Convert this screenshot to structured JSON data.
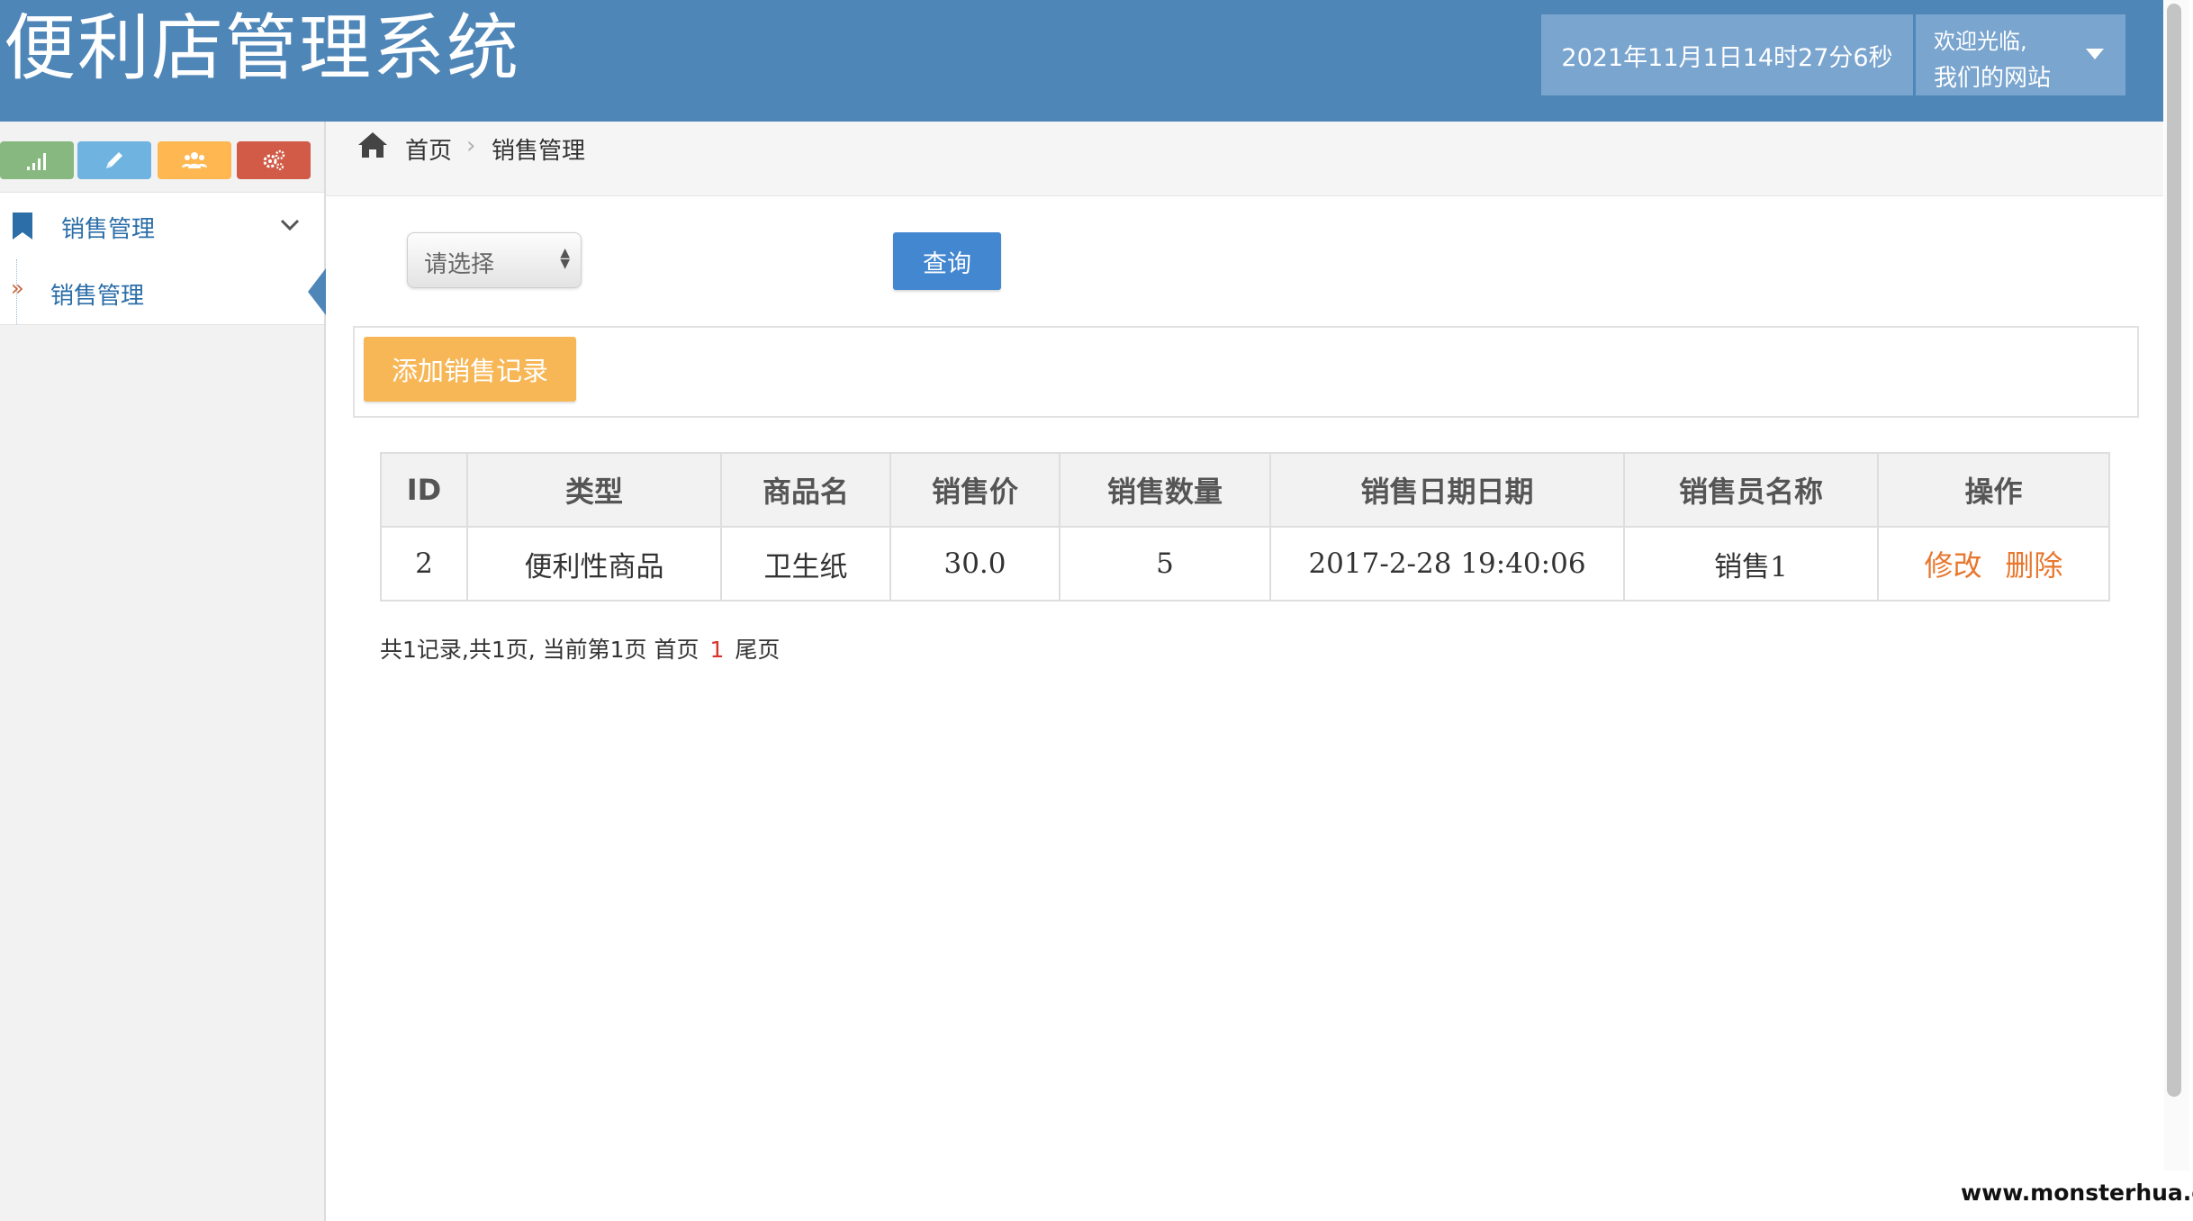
{
  "header": {
    "title": "便利店管理系统",
    "datetime": "2021年11月1日14时27分6秒",
    "welcome": "欢迎光临,",
    "site_name": "我们的网站"
  },
  "sidebar": {
    "shortcuts": [
      {
        "icon": "signal-icon",
        "color": "#87b87f"
      },
      {
        "icon": "pencil-icon",
        "color": "#6fb3e0"
      },
      {
        "icon": "group-icon",
        "color": "#ffb752"
      },
      {
        "icon": "cogs-icon",
        "color": "#d15b47"
      }
    ],
    "menu_parent": {
      "label": "销售管理",
      "icon": "bookmark-icon"
    },
    "menu_child": {
      "label": "销售管理",
      "marker": "»"
    }
  },
  "breadcrumb": {
    "home": "首页",
    "separator": "›",
    "current": "销售管理"
  },
  "filter": {
    "select_value": "请选择",
    "query_label": "查询"
  },
  "toolbar": {
    "add_label": "添加销售记录"
  },
  "table": {
    "headers": [
      "ID",
      "类型",
      "商品名",
      "销售价",
      "销售数量",
      "销售日期日期",
      "销售员名称",
      "操作"
    ],
    "rows": [
      {
        "id": "2",
        "type": "便利性商品",
        "name": "卫生纸",
        "price": "30.0",
        "qty": "5",
        "date": "2017-2-28 19:40:06",
        "seller": "销售1",
        "edit": "修改",
        "delete": "删除"
      }
    ]
  },
  "pagination": {
    "summary": "共1记录,共1页, 当前第1页 首页",
    "current": "1",
    "last": "尾页"
  },
  "watermark": "www.monsterhua.com",
  "colors": {
    "header_bg": "#4f86b8",
    "query_btn": "#4287d0",
    "add_btn": "#f7b756",
    "action_link": "#e8772e",
    "current_page": "#d9342b"
  }
}
